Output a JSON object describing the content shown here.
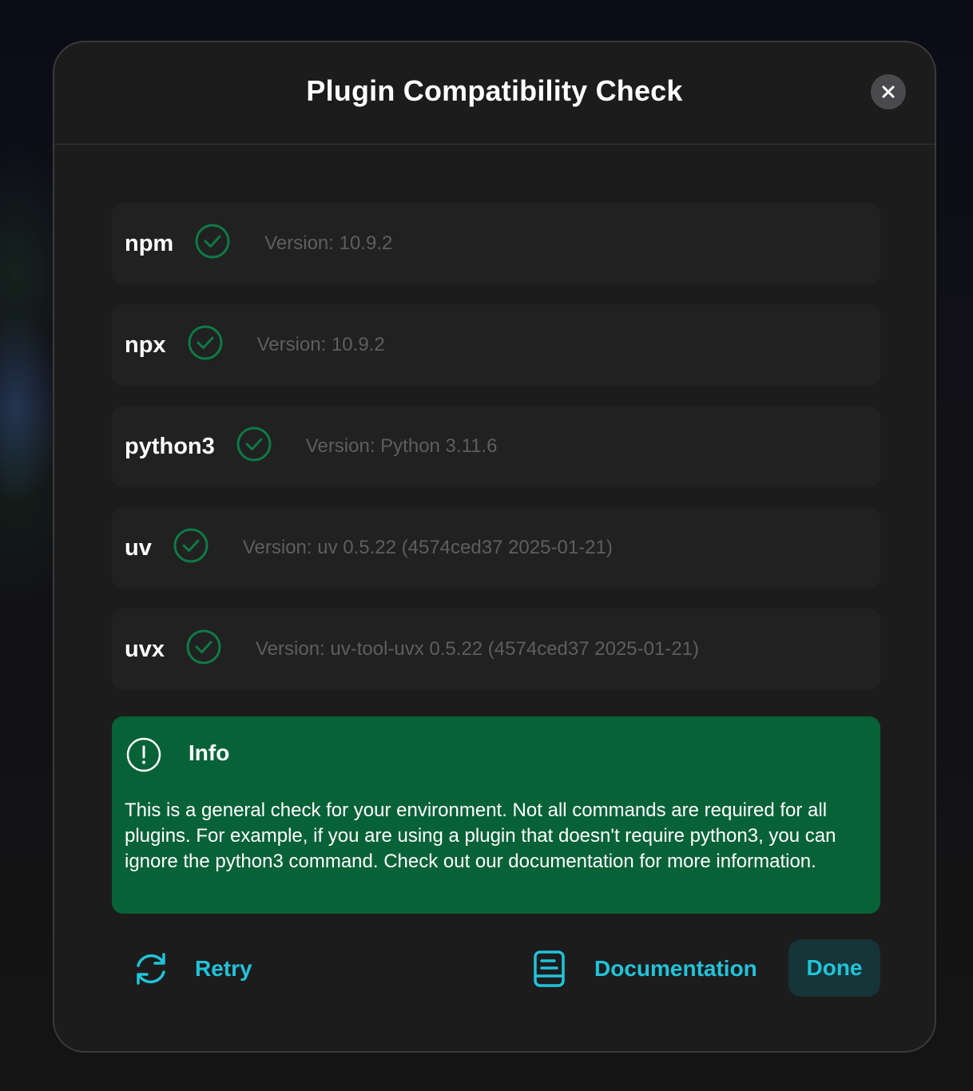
{
  "dialog": {
    "title": "Plugin Compatibility Check",
    "close_icon": "close-icon"
  },
  "checks": [
    {
      "name": "npm",
      "status": "ok",
      "version": "Version: 10.9.2"
    },
    {
      "name": "npx",
      "status": "ok",
      "version": "Version: 10.9.2"
    },
    {
      "name": "python3",
      "status": "ok",
      "version": "Version: Python 3.11.6"
    },
    {
      "name": "uv",
      "status": "ok",
      "version": "Version: uv 0.5.22 (4574ced37 2025-01-21)"
    },
    {
      "name": "uvx",
      "status": "ok",
      "version": "Version: uv-tool-uvx 0.5.22 (4574ced37 2025-01-21)"
    }
  ],
  "info": {
    "icon": "alert-circle-icon",
    "title": "Info",
    "body": "This is a general check for your environment. Not all commands are required for all plugins. For example, if you are using a plugin that doesn't require python3, you can ignore the python3 command. Check out our documentation for more information."
  },
  "footer": {
    "retry_label": "Retry",
    "retry_icon": "refresh-icon",
    "documentation_label": "Documentation",
    "documentation_icon": "document-icon",
    "done_label": "Done"
  },
  "colors": {
    "check_ok": "#0e7a45",
    "info_bg": "#086237",
    "accent": "#22c3d9",
    "dialog_bg": "#1c1c1c"
  }
}
